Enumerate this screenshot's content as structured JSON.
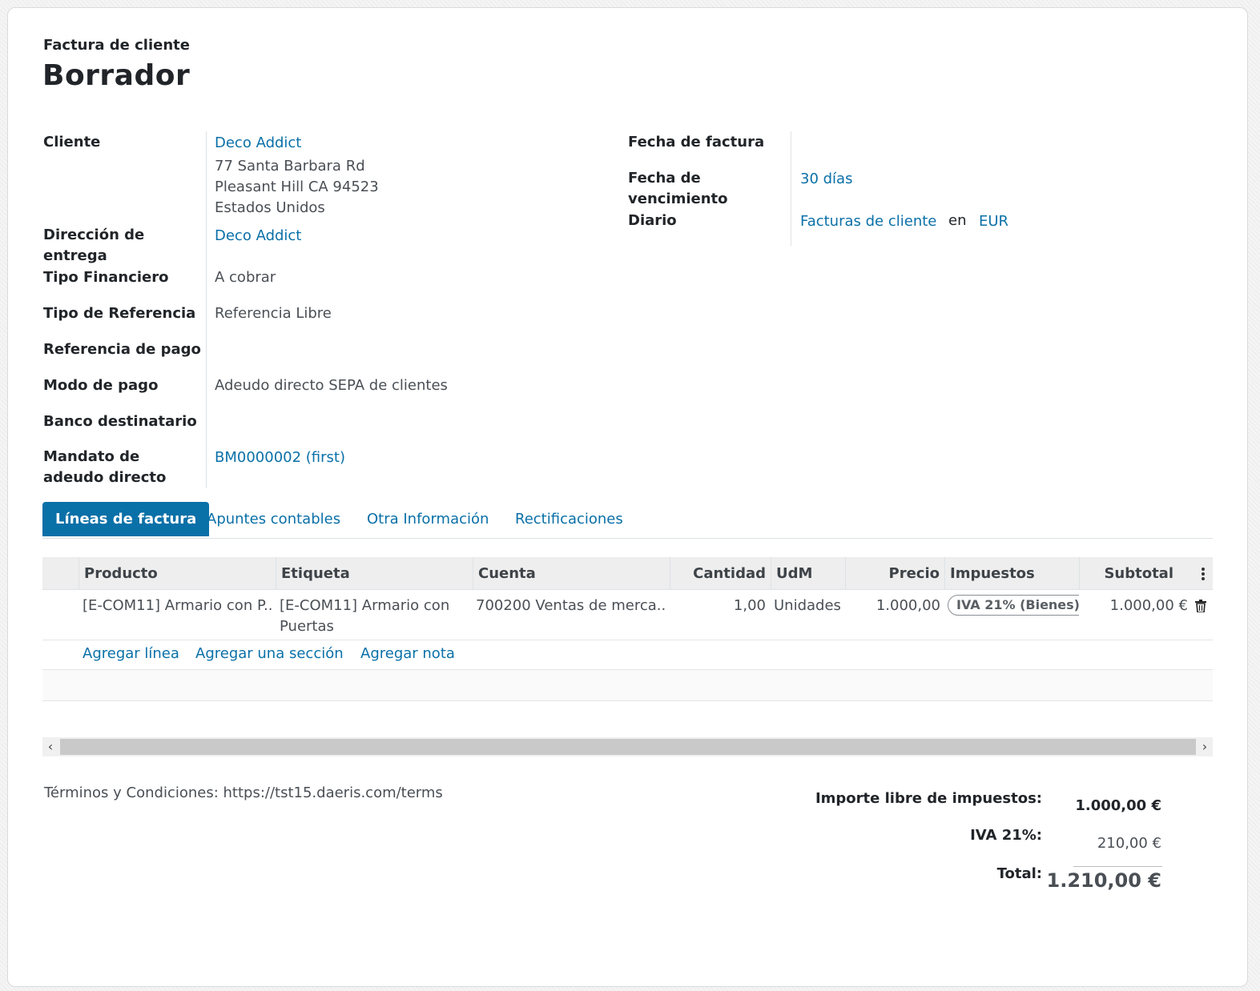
{
  "header": {
    "subtitle": "Factura de cliente",
    "title": "Borrador"
  },
  "left_fields": {
    "cliente_label": "Cliente",
    "cliente_name": "Deco Addict",
    "cliente_addr1": "77 Santa Barbara Rd",
    "cliente_addr2": "Pleasant Hill CA 94523",
    "cliente_addr3": "Estados Unidos",
    "entrega_label_1": "Dirección de",
    "entrega_label_2": "entrega",
    "entrega_value": "Deco Addict",
    "tipo_fin_label": "Tipo Financiero",
    "tipo_fin_value": "A cobrar",
    "tipo_ref_label": "Tipo de Referencia",
    "tipo_ref_value": "Referencia Libre",
    "ref_pago_label": "Referencia de pago",
    "modo_pago_label": "Modo de pago",
    "modo_pago_value": "Adeudo directo SEPA de clientes",
    "banco_label": "Banco destinatario",
    "mandato_label_1": "Mandato de",
    "mandato_label_2": "adeudo directo",
    "mandato_value": "BM0000002 (first)"
  },
  "right_fields": {
    "fecha_factura_label": "Fecha de factura",
    "fecha_venc_label_1": "Fecha de",
    "fecha_venc_label_2": "vencimiento",
    "fecha_venc_value": "30 días",
    "diario_label": "Diario",
    "diario_value": "Facturas de cliente",
    "diario_en": "en",
    "diario_currency": "EUR"
  },
  "tabs": [
    {
      "label": "Líneas de factura"
    },
    {
      "label": "Apuntes contables"
    },
    {
      "label": "Otra Información"
    },
    {
      "label": "Rectificaciones"
    }
  ],
  "table": {
    "headers": {
      "producto": "Producto",
      "etiqueta": "Etiqueta",
      "cuenta": "Cuenta",
      "cantidad": "Cantidad",
      "udm": "UdM",
      "precio": "Precio",
      "impuestos": "Impuestos",
      "subtotal": "Subtotal"
    },
    "row": {
      "producto": "[E-COM11] Armario con P...",
      "etiqueta_1": "[E-COM11] Armario con",
      "etiqueta_2": "Puertas",
      "cuenta": "700200 Ventas de merca...",
      "cantidad": "1,00",
      "udm": "Unidades",
      "precio": "1.000,00",
      "impuesto": "IVA 21% (Bienes)",
      "subtotal": "1.000,00 €"
    },
    "add_links": {
      "linea": "Agregar línea",
      "seccion": "Agregar una sección",
      "nota": "Agregar nota"
    }
  },
  "footer": {
    "terms": "Términos y Condiciones: https://tst15.daeris.com/terms",
    "untaxed_label": "Importe libre de impuestos:",
    "untaxed_value": "1.000,00 €",
    "iva_label": "IVA 21%:",
    "iva_value": "210,00 €",
    "total_label": "Total:",
    "total_value": "1.210,00 €"
  },
  "colors": {
    "link": "#0a70a8",
    "tab_active_bg": "#0a70a8"
  },
  "icons": {
    "trash": "trash-icon",
    "options": "kebab-menu-icon",
    "scroll_left": "chevron-left-icon",
    "scroll_right": "chevron-right-icon"
  }
}
